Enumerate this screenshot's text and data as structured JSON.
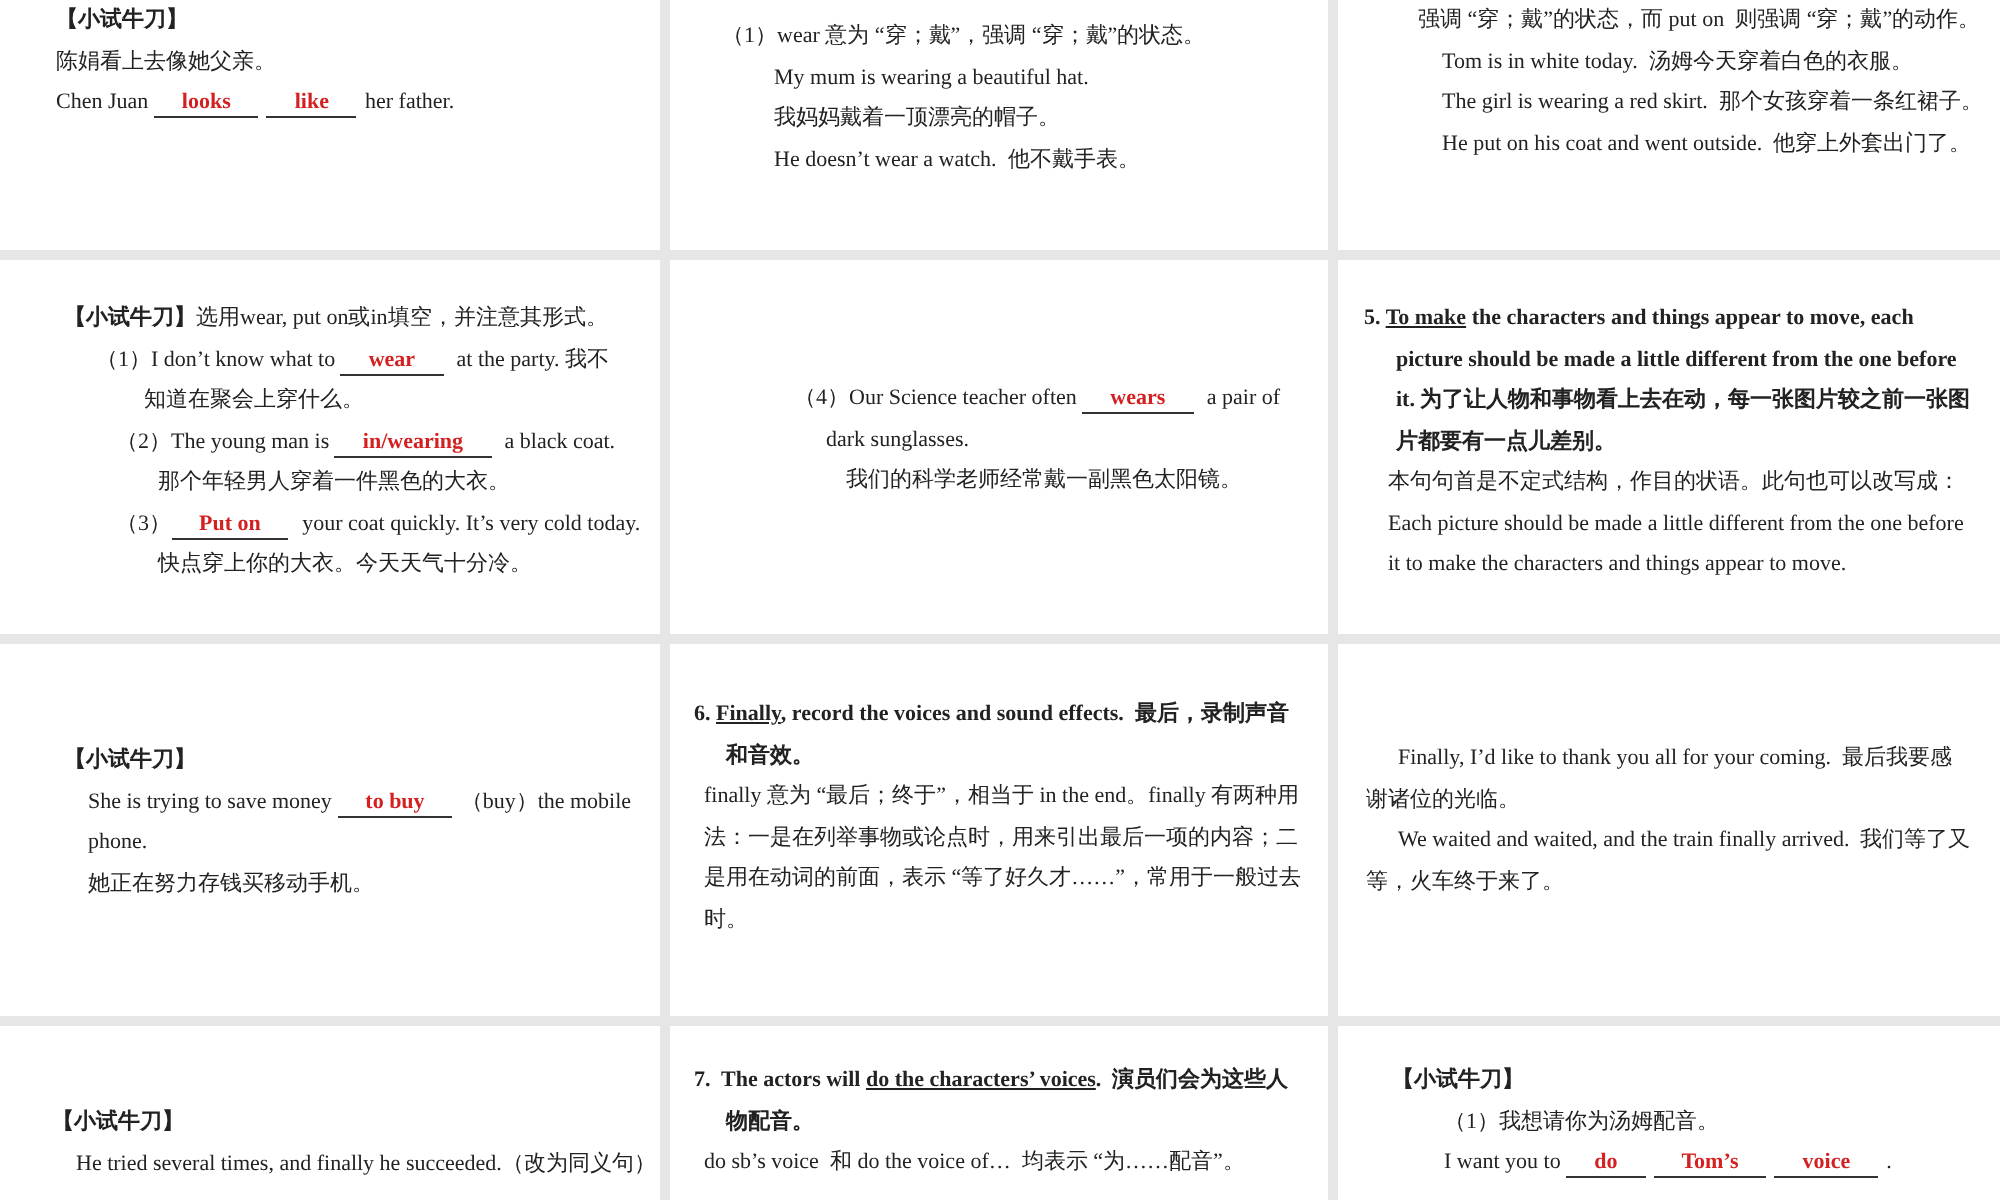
{
  "slides": [
    {
      "lines": [
        {
          "kind": "flush",
          "parts": [
            {
              "kind": "bold",
              "text": "【小试牛刀】"
            }
          ]
        },
        {
          "kind": "flush",
          "parts": [
            {
              "kind": "plain",
              "text": "陈娟看上去像她父亲。"
            }
          ]
        },
        {
          "kind": "flush",
          "parts": [
            {
              "kind": "plain",
              "text": "Chen Juan "
            },
            {
              "kind": "blank",
              "text": "looks"
            },
            {
              "kind": "blank",
              "text": "like"
            },
            {
              "kind": "plain",
              "text": "her father."
            }
          ]
        }
      ]
    },
    {
      "lines": [
        {
          "kind": "flush",
          "parts": [
            {
              "kind": "plain",
              "text": "（1）wear 意为 “穿；戴”，强调 “穿；戴”的状态。"
            }
          ]
        },
        {
          "kind": "sub",
          "parts": [
            {
              "kind": "plain",
              "text": "My mum is wearing a beautiful hat."
            }
          ]
        },
        {
          "kind": "sub",
          "parts": [
            {
              "kind": "plain",
              "text": "我妈妈戴着一顶漂亮的帽子。"
            }
          ]
        },
        {
          "kind": "sub",
          "parts": [
            {
              "kind": "plain",
              "text": "He doesn’t wear a watch.  他不戴手表。"
            }
          ]
        }
      ]
    },
    {
      "lines": [
        {
          "kind": "flush",
          "parts": [
            {
              "kind": "plain",
              "text": "强调 “穿；戴”的状态，而 put on  则强调 “穿；戴”的动作。"
            }
          ]
        },
        {
          "kind": "hang",
          "parts": [
            {
              "kind": "plain",
              "text": "Tom is in white today.  汤姆今天穿着白色的衣服。"
            }
          ]
        },
        {
          "kind": "hang",
          "parts": [
            {
              "kind": "plain",
              "text": "The girl is wearing a red skirt.  那个女孩穿着一条红裙子。"
            }
          ]
        },
        {
          "kind": "hang",
          "parts": [
            {
              "kind": "plain",
              "text": "He put on his coat and went outside.  他穿上外套出门了。"
            }
          ]
        }
      ]
    },
    {
      "lines": [
        {
          "kind": "flush",
          "parts": [
            {
              "kind": "bold",
              "text": "【小试牛刀】"
            },
            {
              "kind": "plain",
              "text": "选用wear, put on或in填空，并注意其形式。"
            }
          ]
        },
        {
          "kind": "indent",
          "parts": [
            {
              "kind": "plain",
              "text": "（1）I don’t know what to "
            },
            {
              "kind": "blank",
              "text": "wear"
            },
            {
              "kind": "plain",
              "text": " at the party. 我不"
            }
          ]
        },
        {
          "kind": "deep",
          "parts": [
            {
              "kind": "plain",
              "text": "知道在聚会上穿什么。"
            }
          ]
        },
        {
          "kind": "sub",
          "parts": [
            {
              "kind": "plain",
              "text": "（2）The young man is "
            },
            {
              "kind": "blank",
              "text": "in/wearing"
            },
            {
              "kind": "plain",
              "text": " a black coat."
            }
          ]
        },
        {
          "kind": "deeper",
          "parts": [
            {
              "kind": "plain",
              "text": "那个年轻男人穿着一件黑色的大衣。"
            }
          ]
        },
        {
          "kind": "sub",
          "parts": [
            {
              "kind": "plain",
              "text": "（3）"
            },
            {
              "kind": "blank",
              "text": "Put on"
            },
            {
              "kind": "plain",
              "text": " your coat quickly. It’s very cold today."
            }
          ]
        },
        {
          "kind": "deeper",
          "parts": [
            {
              "kind": "plain",
              "text": "快点穿上你的大衣。今天天气十分冷。"
            }
          ]
        }
      ]
    },
    {
      "lines": [
        {
          "kind": "flush",
          "parts": [
            {
              "kind": "plain",
              "text": "（4）Our Science teacher often "
            },
            {
              "kind": "blank",
              "text": "wears"
            },
            {
              "kind": "plain",
              "text": " a pair of"
            }
          ]
        },
        {
          "kind": "indent",
          "parts": [
            {
              "kind": "plain",
              "text": "dark sunglasses."
            }
          ]
        },
        {
          "kind": "sub",
          "parts": [
            {
              "kind": "plain",
              "text": "我们的科学老师经常戴一副黑色太阳镜。"
            }
          ]
        }
      ]
    },
    {
      "lines": [
        {
          "kind": "flush",
          "parts": [
            {
              "kind": "bold",
              "text": "5. "
            },
            {
              "kind": "under",
              "text": "To make"
            },
            {
              "kind": "bold",
              "text": " the characters and things appear to move, each"
            }
          ]
        },
        {
          "kind": "indent",
          "parts": [
            {
              "kind": "bold",
              "text": "picture should be made a little different from the one before"
            }
          ]
        },
        {
          "kind": "indent",
          "parts": [
            {
              "kind": "bold",
              "text": "it. 为了让人物和事物看上去在动，每一张图片较之前一张图"
            }
          ]
        },
        {
          "kind": "indent",
          "parts": [
            {
              "kind": "bold",
              "text": "片都要有一点儿差别。"
            }
          ]
        },
        {
          "kind": "hang",
          "parts": [
            {
              "kind": "plain",
              "text": "本句句首是不定式结构，作目的状语。此句也可以改写成："
            }
          ]
        },
        {
          "kind": "hang",
          "parts": [
            {
              "kind": "plain",
              "text": "Each picture should be made a little different from the one before"
            }
          ]
        },
        {
          "kind": "hang",
          "parts": [
            {
              "kind": "plain",
              "text": "it to make the characters and things appear to move."
            }
          ]
        }
      ]
    },
    {
      "lines": [
        {
          "kind": "flush",
          "parts": [
            {
              "kind": "bold",
              "text": "【小试牛刀】"
            }
          ]
        },
        {
          "kind": "hang",
          "parts": [
            {
              "kind": "plain",
              "text": "She is trying to save money "
            },
            {
              "kind": "blank",
              "text": "to buy"
            },
            {
              "kind": "plain",
              "text": "（buy）the mobile"
            }
          ]
        },
        {
          "kind": "hang",
          "parts": [
            {
              "kind": "plain",
              "text": "phone."
            }
          ]
        },
        {
          "kind": "hang",
          "parts": [
            {
              "kind": "plain",
              "text": "她正在努力存钱买移动手机。"
            }
          ]
        }
      ]
    },
    {
      "lines": [
        {
          "kind": "flush",
          "parts": [
            {
              "kind": "bold",
              "text": "6. "
            },
            {
              "kind": "under",
              "text": "Finally"
            },
            {
              "kind": "bold",
              "text": ", record the voices and sound effects.  最后，录制声音"
            }
          ]
        },
        {
          "kind": "indent",
          "parts": [
            {
              "kind": "bold",
              "text": "和音效。"
            }
          ]
        },
        {
          "kind": "nudge",
          "parts": [
            {
              "kind": "plain",
              "text": "finally 意为 “最后；终于”，相当于 in the end。finally 有两种用"
            }
          ]
        },
        {
          "kind": "nudge",
          "parts": [
            {
              "kind": "plain",
              "text": "法：一是在列举事物或论点时，用来引出最后一项的内容；二"
            }
          ]
        },
        {
          "kind": "nudge",
          "parts": [
            {
              "kind": "plain",
              "text": "是用在动词的前面，表示 “等了好久才……”，常用于一般过去"
            }
          ]
        },
        {
          "kind": "nudge",
          "parts": [
            {
              "kind": "plain",
              "text": "时。"
            }
          ]
        }
      ]
    },
    {
      "lines": [
        {
          "kind": "indent",
          "parts": [
            {
              "kind": "plain",
              "text": "Finally, I’d like to thank you all for your coming.  最后我要感"
            }
          ]
        },
        {
          "kind": "flush",
          "parts": [
            {
              "kind": "plain",
              "text": "谢诸位的光临。"
            }
          ]
        },
        {
          "kind": "indent",
          "parts": [
            {
              "kind": "plain",
              "text": "We waited and waited, and the train finally arrived.  我们等了又"
            }
          ]
        },
        {
          "kind": "flush",
          "parts": [
            {
              "kind": "plain",
              "text": "等，火车终于来了。"
            }
          ]
        }
      ]
    },
    {
      "lines": [
        {
          "kind": "flush",
          "parts": [
            {
              "kind": "bold",
              "text": "【小试牛刀】"
            }
          ]
        },
        {
          "kind": "hang",
          "parts": [
            {
              "kind": "plain",
              "text": "He tried several times, and finally he succeeded.（改为同义句）"
            }
          ]
        }
      ]
    },
    {
      "lines": [
        {
          "kind": "flush",
          "parts": [
            {
              "kind": "bold",
              "text": "7.  The actors will "
            },
            {
              "kind": "under",
              "text": "do the characters’ voices"
            },
            {
              "kind": "bold",
              "text": ".  演员们会为这些人"
            }
          ]
        },
        {
          "kind": "indent",
          "parts": [
            {
              "kind": "bold",
              "text": "物配音。"
            }
          ]
        },
        {
          "kind": "nudge",
          "parts": [
            {
              "kind": "plain",
              "text": "do sb’s voice  和 do the voice of…  均表示 “为……配音”。"
            }
          ]
        }
      ]
    },
    {
      "lines": [
        {
          "kind": "flush",
          "parts": [
            {
              "kind": "bold",
              "text": "【小试牛刀】"
            }
          ]
        },
        {
          "kind": "sub",
          "parts": [
            {
              "kind": "plain",
              "text": "（1）我想请你为汤姆配音。"
            }
          ]
        },
        {
          "kind": "sub",
          "parts": [
            {
              "kind": "plain",
              "text": "I want you to "
            },
            {
              "kind": "blank",
              "text": "do"
            },
            {
              "kind": "blank",
              "text": "Tom’s"
            },
            {
              "kind": "blank",
              "text": "voice"
            },
            {
              "kind": "plain",
              "text": "."
            }
          ]
        }
      ]
    }
  ]
}
